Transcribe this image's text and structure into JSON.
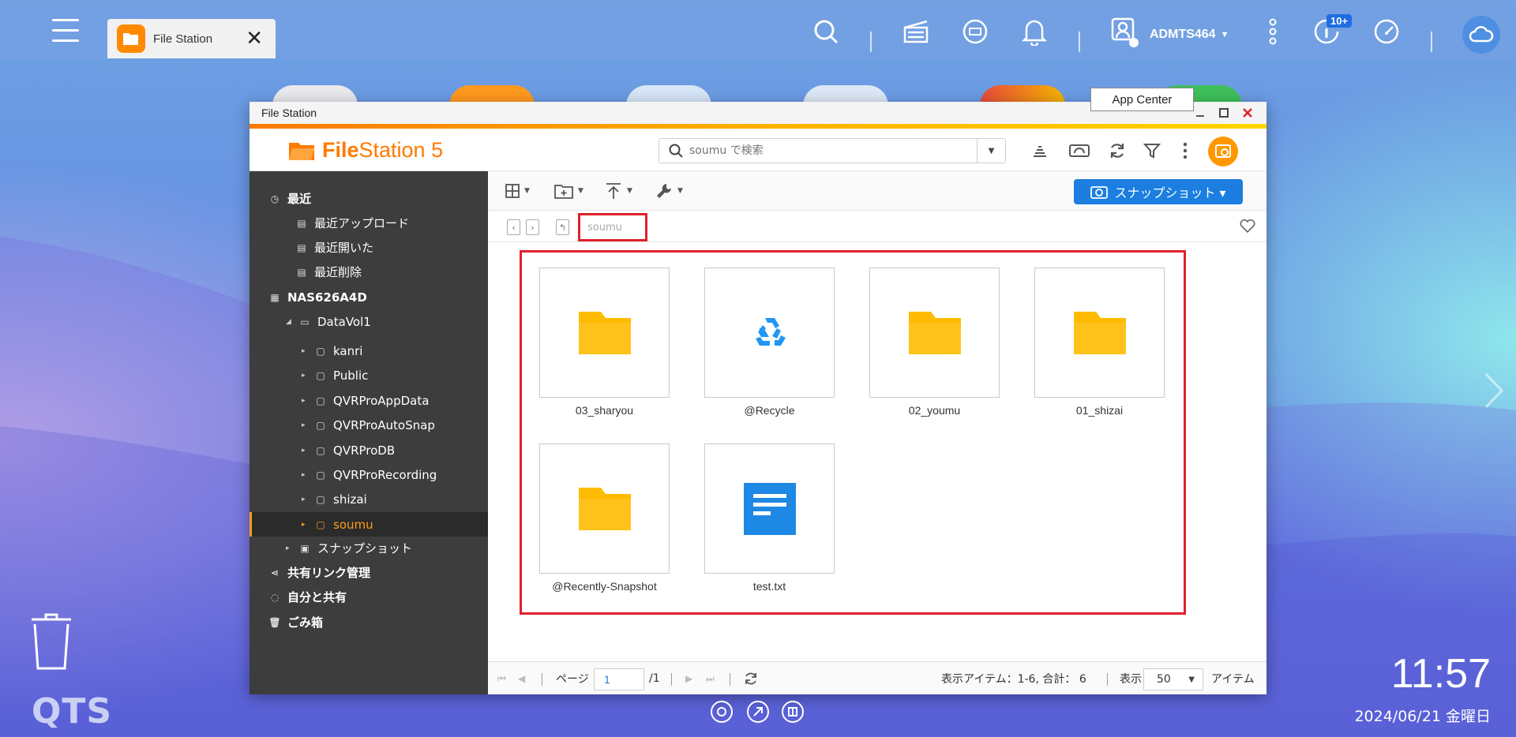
{
  "taskbar": {
    "tab_label": "File Station",
    "tab_close": "✕",
    "username": "ADMTS464",
    "notification_badge": "10+"
  },
  "tooltip": "App Center",
  "window": {
    "title": "File Station",
    "brand_file": "File",
    "brand_station": "Station 5",
    "search_placeholder": "soumu で検索"
  },
  "sidebar": {
    "recent": "最近",
    "recent_items": [
      "最近アップロード",
      "最近開いた",
      "最近削除"
    ],
    "nas_name": "NAS626A4D",
    "volume": "DataVol1",
    "folders": [
      "kanri",
      "Public",
      "QVRProAppData",
      "QVRProAutoSnap",
      "QVRProDB",
      "QVRProRecording",
      "shizai",
      "soumu"
    ],
    "snapshot": "スナップショット",
    "share_link": "共有リンク管理",
    "shared_with_me": "自分と共有",
    "trash": "ごみ箱"
  },
  "toolbar": {
    "snapshot_button": "スナップショット ▾"
  },
  "path": {
    "current": "soumu"
  },
  "files": [
    {
      "name": "03_sharyou",
      "type": "folder"
    },
    {
      "name": "@Recycle",
      "type": "recycle"
    },
    {
      "name": "02_youmu",
      "type": "folder"
    },
    {
      "name": "01_shizai",
      "type": "folder"
    },
    {
      "name": "@Recently-Snapshot",
      "type": "folder"
    },
    {
      "name": "test.txt",
      "type": "text"
    }
  ],
  "footer": {
    "page_label": "ページ",
    "page_value": "1",
    "page_total": "/1",
    "items_info": "表示アイテム：1-6, 合計：  6",
    "display_label": "表示",
    "per_page": "50",
    "items_label": "アイテム"
  },
  "clock": {
    "time": "11:57",
    "date": "2024/06/21 金曜日"
  },
  "brand_text": "QTS",
  "colors": {
    "accent_orange": "#ff7a00",
    "folder_yellow": "#ffbb00",
    "highlight_red": "#e0212b",
    "primary_blue": "#1b7ee0"
  }
}
